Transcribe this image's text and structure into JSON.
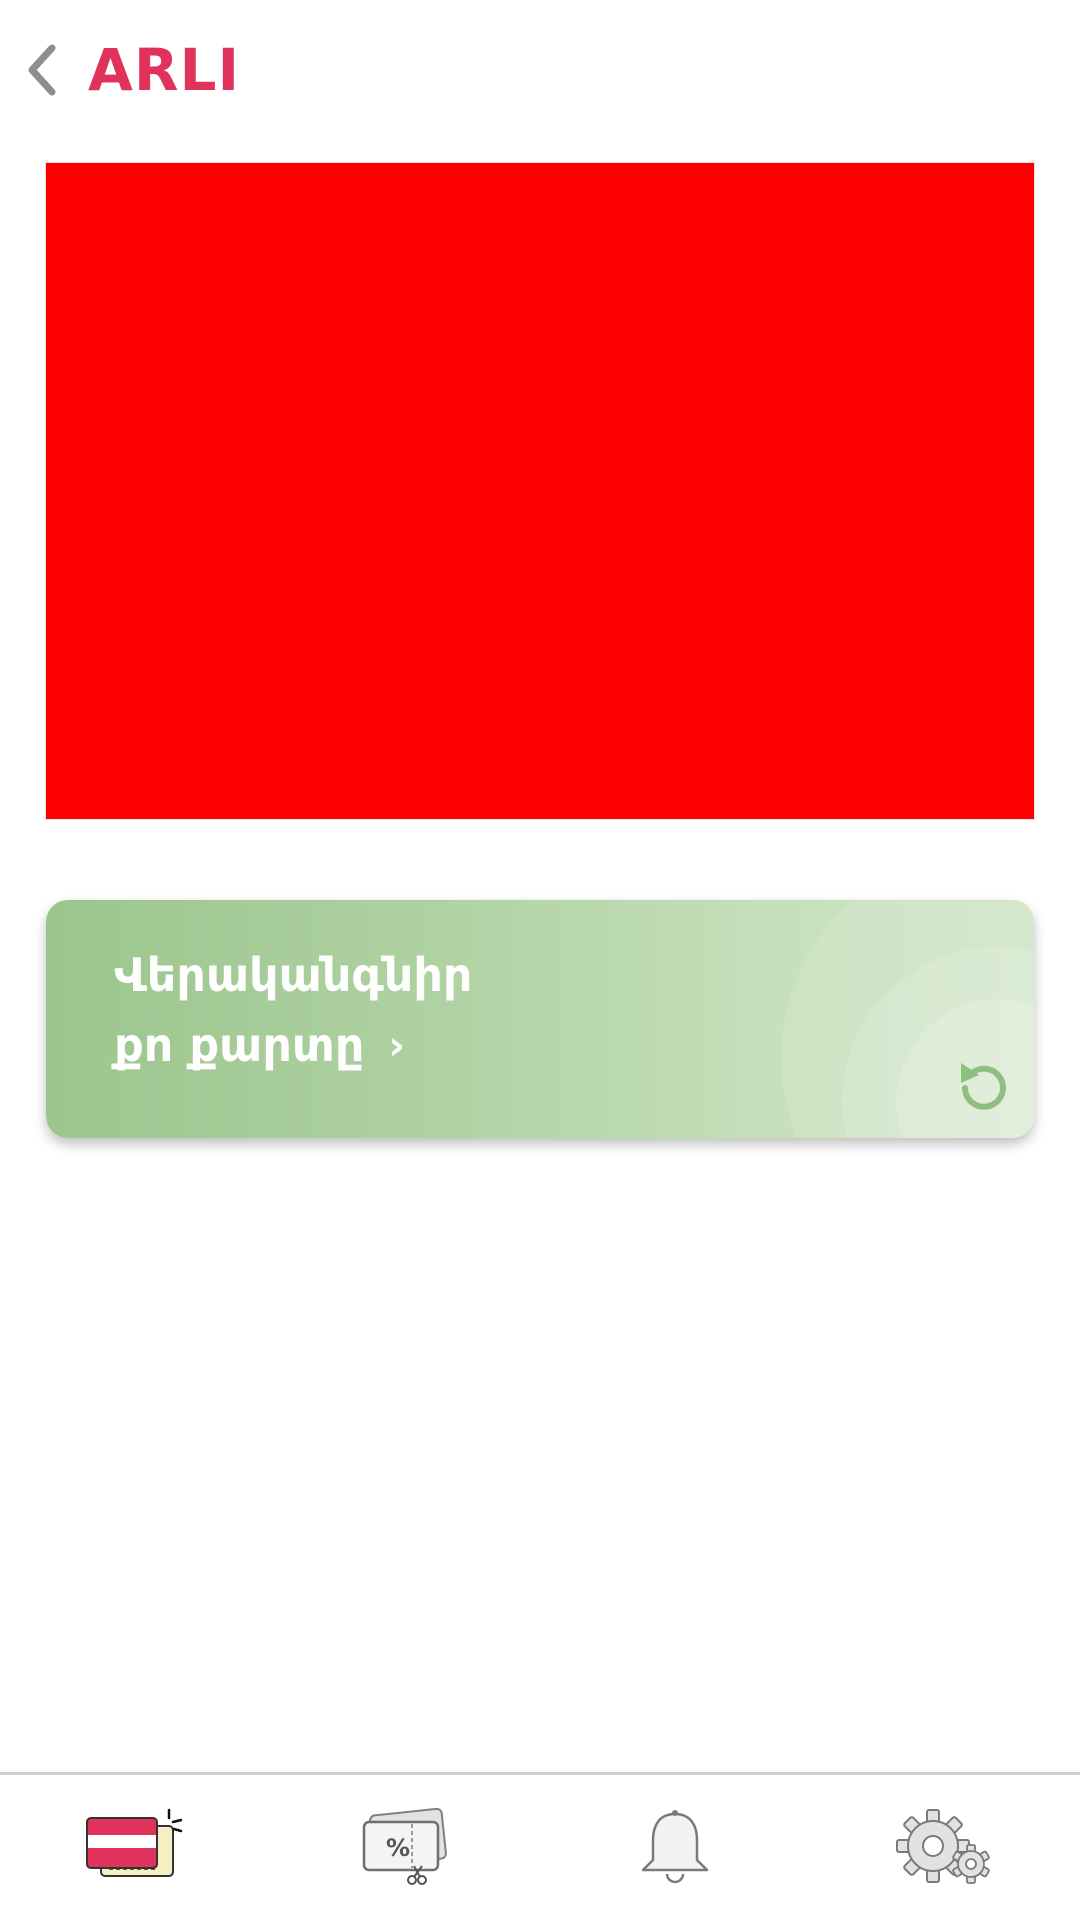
{
  "header": {
    "title": "ARLI",
    "back_icon": "chevron-left-icon"
  },
  "card": {
    "color": "#ff0000"
  },
  "restore_banner": {
    "line1": "Վերականգնիր",
    "line2": "քո քարտը",
    "chevron": "›",
    "icon": "refresh-icon",
    "gradient_start": "#9cc58e",
    "gradient_end": "#cfe5c6"
  },
  "colors": {
    "accent": "#e0325a",
    "nav_border": "#d0d0d0"
  },
  "bottom_nav": {
    "items": [
      {
        "icon": "card-icon",
        "active": true
      },
      {
        "icon": "discount-coupon-icon",
        "active": false
      },
      {
        "icon": "bell-icon",
        "active": false
      },
      {
        "icon": "settings-gears-icon",
        "active": false
      }
    ]
  }
}
